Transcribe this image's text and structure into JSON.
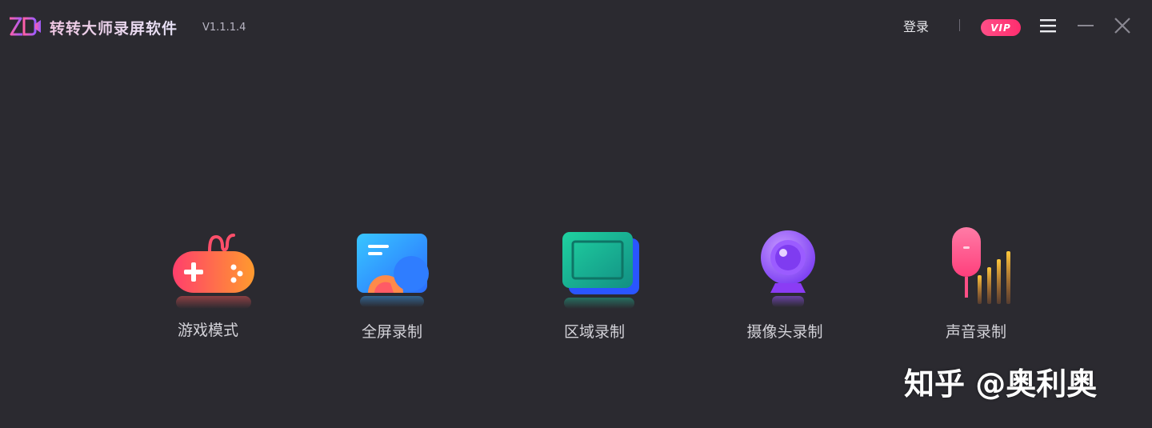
{
  "app": {
    "title": "转转大师录屏软件",
    "version": "V1.1.1.4"
  },
  "header": {
    "login": "登录",
    "separator": "|",
    "vip": "VIP"
  },
  "window_controls": {
    "menu_icon": "hamburger-icon",
    "minimize_icon": "minimize-icon",
    "close_icon": "close-icon"
  },
  "modes": [
    {
      "label": "游戏模式",
      "icon": "gamepad-icon"
    },
    {
      "label": "全屏录制",
      "icon": "fullscreen-icon"
    },
    {
      "label": "区域录制",
      "icon": "region-icon"
    },
    {
      "label": "摄像头录制",
      "icon": "webcam-icon"
    },
    {
      "label": "声音录制",
      "icon": "microphone-icon"
    }
  ],
  "watermark": "知乎 @奥利奥",
  "colors": {
    "background": "#2b2a30",
    "vip_badge": "#ff3f7a",
    "logo": "#b35cff"
  }
}
